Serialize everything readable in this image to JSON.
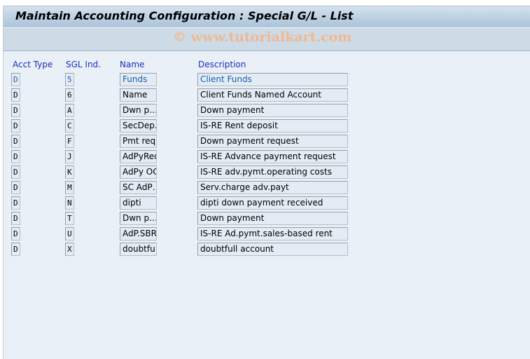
{
  "window": {
    "title": "Maintain Accounting Configuration : Special G/L - List",
    "watermark": "© www.tutorialkart.com"
  },
  "table": {
    "columns": [
      "Acct Type",
      "SGL Ind.",
      "Name",
      "Description"
    ],
    "rows": [
      {
        "acct_type": "D",
        "sgl_ind": "5",
        "name": "Funds",
        "description": "Client Funds"
      },
      {
        "acct_type": "D",
        "sgl_ind": "6",
        "name": "Name",
        "description": "Client Funds Named Account"
      },
      {
        "acct_type": "D",
        "sgl_ind": "A",
        "name": "Dwn p…",
        "description": "Down payment"
      },
      {
        "acct_type": "D",
        "sgl_ind": "C",
        "name": "SecDep.",
        "description": "IS-RE Rent deposit"
      },
      {
        "acct_type": "D",
        "sgl_ind": "F",
        "name": "Pmt req",
        "description": "Down payment request"
      },
      {
        "acct_type": "D",
        "sgl_ind": "J",
        "name": "AdPyReq",
        "description": "IS-RE Advance payment request"
      },
      {
        "acct_type": "D",
        "sgl_ind": "K",
        "name": "AdPy OC",
        "description": "IS-RE adv.pymt.operating costs"
      },
      {
        "acct_type": "D",
        "sgl_ind": "M",
        "name": "SC AdP…",
        "description": "Serv.charge adv.payt"
      },
      {
        "acct_type": "D",
        "sgl_ind": "N",
        "name": "dipti",
        "description": "dipti down payment received"
      },
      {
        "acct_type": "D",
        "sgl_ind": "T",
        "name": "Dwn p…",
        "description": "Down payment"
      },
      {
        "acct_type": "D",
        "sgl_ind": "U",
        "name": "AdP.SBR",
        "description": "IS-RE Ad.pymt.sales-based rent"
      },
      {
        "acct_type": "D",
        "sgl_ind": "X",
        "name": "doubtfu",
        "description": "doubtfull account"
      }
    ]
  },
  "colors": {
    "header_text": "#1a2dbd",
    "selected_row_text": "#1a5fa8"
  }
}
